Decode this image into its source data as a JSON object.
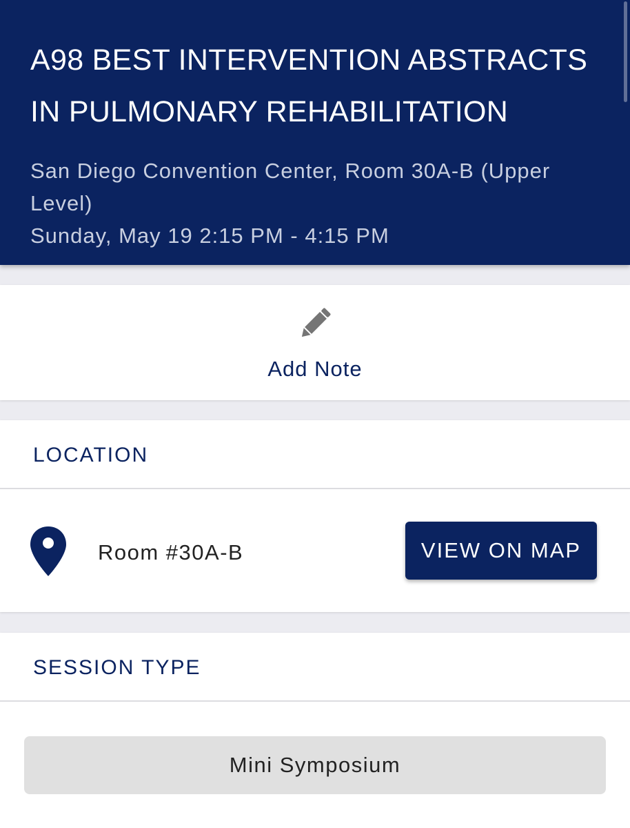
{
  "session": {
    "title": "A98 BEST INTERVENTION ABSTRACTS IN PULMONARY REHABILITATION",
    "venue": "San Diego Convention Center, Room 30A-B (Upper Level)",
    "datetime": "Sunday, May 19 2:15 PM - 4:15 PM"
  },
  "note": {
    "icon": "pencil-icon",
    "label": "Add Note"
  },
  "location": {
    "header": "LOCATION",
    "icon": "map-pin-icon",
    "room": "Room #30A-B",
    "map_button_label": "VIEW ON MAP"
  },
  "session_type": {
    "header": "SESSION TYPE",
    "value": "Mini Symposium"
  },
  "colors": {
    "brand_navy": "#0b2360",
    "page_background": "#ececf1",
    "chip_background": "#e0e0e0",
    "icon_gray": "#757575"
  }
}
